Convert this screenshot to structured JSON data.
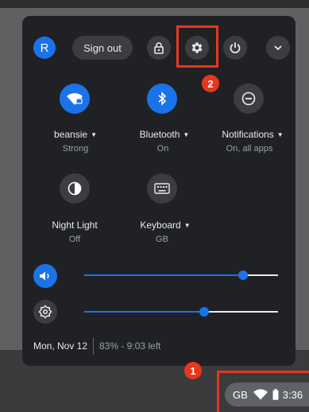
{
  "header": {
    "avatar_letter": "R",
    "sign_out_label": "Sign out"
  },
  "tiles": [
    {
      "label": "beansie",
      "status": "Strong",
      "icon": "wifi-icon",
      "active": true
    },
    {
      "label": "Bluetooth",
      "status": "On",
      "icon": "bluetooth-icon",
      "active": true
    },
    {
      "label": "Notifications",
      "status": "On, all apps",
      "icon": "notifications-icon",
      "active": false
    },
    {
      "label": "Night Light",
      "status": "Off",
      "icon": "night-light-icon",
      "active": false
    },
    {
      "label": "Keyboard",
      "status": "GB",
      "icon": "keyboard-icon",
      "active": false
    }
  ],
  "sliders": {
    "volume_level": 0.82,
    "brightness_level": 0.62
  },
  "footer": {
    "date": "Mon, Nov 12",
    "battery": "83% - 9:03 left"
  },
  "tray": {
    "keyboard": "GB",
    "time": "3:36"
  },
  "annotations": {
    "step1": "1",
    "step2": "2"
  },
  "colors": {
    "accent": "#1a73e8",
    "highlight": "#e8361f",
    "panel": "#202124"
  }
}
